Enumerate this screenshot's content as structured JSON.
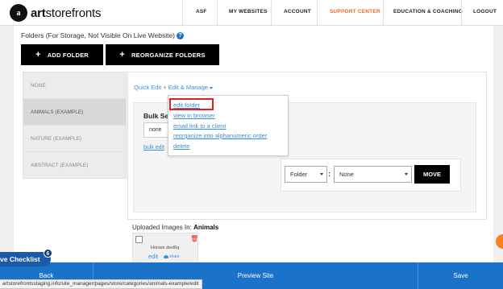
{
  "brand": {
    "logo_mark": "a",
    "name_bold": "art",
    "name_rest": "storefronts"
  },
  "nav": {
    "items": [
      {
        "label": "ASF"
      },
      {
        "label": "MY WEBSITES"
      },
      {
        "label": "ACCOUNT"
      },
      {
        "label": "SUPPORT CENTER"
      },
      {
        "label": "EDUCATION & COACHING"
      },
      {
        "label": "LOGOUT"
      }
    ],
    "active_color": "#f26b21"
  },
  "folders": {
    "heading": "Folders (For Storage, Not Visible On Live Website)",
    "help_icon": "?",
    "add_button": "ADD FOLDER",
    "reorganize_button": "REORGANIZE FOLDERS",
    "list": [
      {
        "label": "NONE"
      },
      {
        "label": "ANIMALS (EXAMPLE)",
        "selected": true
      },
      {
        "label": "NATURE (EXAMPLE)"
      },
      {
        "label": "ABSTRACT (EXAMPLE)"
      }
    ]
  },
  "quick_edit": {
    "label": "Quick Edit + Edit & Manage",
    "menu": [
      {
        "label": "edit folder"
      },
      {
        "label": "view in browser"
      },
      {
        "label": "email link to a client"
      },
      {
        "label": "reorganize into alphanumeric order"
      },
      {
        "label": "delete"
      }
    ]
  },
  "bulk": {
    "title": "Bulk Sel",
    "select_value": "none",
    "edit_link": "bulk edit"
  },
  "move": {
    "type_value": "Folder",
    "colon": ":",
    "target_value": "None",
    "button": "MOVE"
  },
  "uploaded": {
    "prefix": "Uploaded Images In:",
    "folder": "Animals",
    "thumb_name": "Horses dsvt6q",
    "edit": "edit",
    "share": "share"
  },
  "bottom": {
    "back": "Back",
    "preview": "Preview Site",
    "save": "Save",
    "checklist": "ve Checklist",
    "badge": "6"
  },
  "status_url": "artstorefrontsstaging.info/site_manager/pages/store/categories/animals-example/edit",
  "colors": {
    "accent_blue": "#1a73c9",
    "link_blue": "#3a8ed6",
    "highlight_red": "#e02020",
    "orange": "#f58220"
  }
}
